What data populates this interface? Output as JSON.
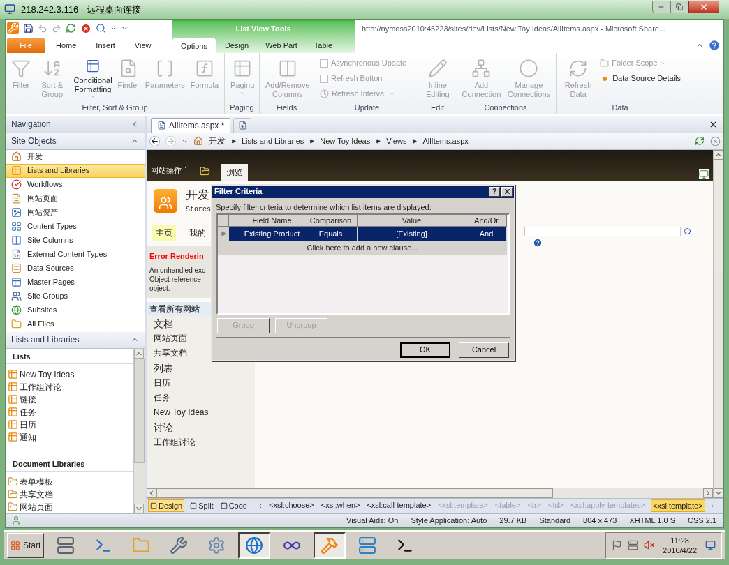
{
  "window": {
    "title": "218.242.3.116 - 远程桌面连接"
  },
  "app": {
    "title": "http://nymoss2010:45223/sites/dev/Lists/New Toy Ideas/AllItems.aspx  -  Microsoft Share...",
    "contextual_group": "List View Tools"
  },
  "ribbon_tabs": [
    {
      "label": "File",
      "kind": "file",
      "selected": false
    },
    {
      "label": "Home",
      "kind": "plain",
      "selected": false
    },
    {
      "label": "Insert",
      "kind": "plain",
      "selected": false
    },
    {
      "label": "View",
      "kind": "plain",
      "selected": false
    },
    {
      "label": "Options",
      "kind": "contextual",
      "selected": true
    },
    {
      "label": "Design",
      "kind": "contextual",
      "selected": false
    },
    {
      "label": "Web Part",
      "kind": "contextual",
      "selected": false
    },
    {
      "label": "Table",
      "kind": "contextual",
      "selected": false
    }
  ],
  "ribbon_groups": [
    {
      "title": "Filter, Sort & Group",
      "commands": [
        {
          "label": "Filter",
          "kind": "large",
          "disabled": true,
          "dropdown": false
        },
        {
          "label": "Sort & Group",
          "kind": "large",
          "disabled": true,
          "dropdown": false
        },
        {
          "label": "Conditional Formatting",
          "kind": "large",
          "disabled": false,
          "dropdown": true
        },
        {
          "label": "Finder",
          "kind": "large",
          "disabled": true,
          "dropdown": false
        },
        {
          "label": "Parameters",
          "kind": "large",
          "disabled": true,
          "dropdown": false
        },
        {
          "label": "Formula",
          "kind": "large",
          "disabled": true,
          "dropdown": false
        }
      ]
    },
    {
      "title": "Paging",
      "commands": [
        {
          "label": "Paging",
          "kind": "large",
          "disabled": true,
          "dropdown": true
        }
      ]
    },
    {
      "title": "Fields",
      "commands": [
        {
          "label": "Add/Remove Columns",
          "kind": "large",
          "disabled": true,
          "dropdown": false
        }
      ]
    },
    {
      "title": "Update",
      "commands": [
        {
          "label": "Asynchronous Update",
          "kind": "checkbox",
          "disabled": true,
          "checked": false
        },
        {
          "label": "Refresh Button",
          "kind": "checkbox",
          "disabled": true,
          "checked": false
        },
        {
          "label": "Refresh Interval",
          "kind": "small",
          "disabled": true,
          "dropdown": true
        }
      ]
    },
    {
      "title": "Edit",
      "commands": [
        {
          "label": "Inline Editing",
          "kind": "large",
          "disabled": true,
          "dropdown": false
        }
      ]
    },
    {
      "title": "Connections",
      "commands": [
        {
          "label": "Add Connection",
          "kind": "large",
          "disabled": true,
          "dropdown": false
        },
        {
          "label": "Manage Connections",
          "kind": "large",
          "disabled": true,
          "dropdown": false
        }
      ]
    },
    {
      "title": "Data",
      "commands": [
        {
          "label": "Refresh Data",
          "kind": "large",
          "disabled": true,
          "dropdown": false
        },
        {
          "label": "Folder Scope",
          "kind": "small",
          "disabled": true,
          "dropdown": true
        },
        {
          "label": "Data Source Details",
          "kind": "small",
          "disabled": false,
          "dropdown": false
        }
      ]
    }
  ],
  "navigation": {
    "title": "Navigation",
    "site_objects": {
      "title": "Site Objects",
      "items": [
        {
          "label": "开发",
          "selected": false
        },
        {
          "label": "Lists and Libraries",
          "selected": true
        },
        {
          "label": "Workflows",
          "selected": false
        },
        {
          "label": "网站页面",
          "selected": false
        },
        {
          "label": "网站资产",
          "selected": false
        },
        {
          "label": "Content Types",
          "selected": false
        },
        {
          "label": "Site Columns",
          "selected": false
        },
        {
          "label": "External Content Types",
          "selected": false
        },
        {
          "label": "Data Sources",
          "selected": false
        },
        {
          "label": "Master Pages",
          "selected": false
        },
        {
          "label": "Site Groups",
          "selected": false
        },
        {
          "label": "Subsites",
          "selected": false
        },
        {
          "label": "All Files",
          "selected": false
        }
      ]
    },
    "lists_and_libraries": {
      "title": "Lists and Libraries",
      "groups": [
        {
          "title": "Lists",
          "kind": "list",
          "items": [
            "New Toy Ideas",
            "工作组讨论",
            "链接",
            "任务",
            "日历",
            "通知"
          ]
        },
        {
          "title": "Document Libraries",
          "kind": "library",
          "items": [
            "表单模板",
            "共享文档",
            "网站页面"
          ]
        }
      ]
    }
  },
  "editor": {
    "tabs": [
      {
        "label": "AllItems.aspx *",
        "selected": true
      }
    ],
    "breadcrumb": [
      "开发",
      "Lists and Libraries",
      "New Toy Ideas",
      "Views",
      "AllItems.aspx"
    ],
    "page": {
      "site_actions": "网站操作",
      "ribbon_tabs": [
        {
          "label": "浏览",
          "selected": true
        }
      ],
      "site_title": "开发",
      "site_subtitle": "Stores",
      "top_links": [
        {
          "label": "主页",
          "selected": true
        },
        {
          "label": "我的",
          "selected": false
        }
      ],
      "error_title": "Error Renderin",
      "error_lines": [
        "An unhandled exc",
        "Object reference",
        "object."
      ],
      "quick_launch_heading": "查看所有网站",
      "quick_launch": [
        {
          "label": "文档",
          "kind": "heading"
        },
        {
          "label": "网站页面",
          "kind": "link"
        },
        {
          "label": "共享文档",
          "kind": "link"
        },
        {
          "label": "列表",
          "kind": "heading"
        },
        {
          "label": "日历",
          "kind": "link"
        },
        {
          "label": "任务",
          "kind": "link"
        },
        {
          "label": "New Toy Ideas",
          "kind": "link"
        },
        {
          "label": "讨论",
          "kind": "heading"
        },
        {
          "label": "工作组讨论",
          "kind": "link"
        }
      ]
    },
    "views": [
      {
        "label": "Design",
        "selected": true
      },
      {
        "label": "Split",
        "selected": false
      },
      {
        "label": "Code",
        "selected": false
      }
    ],
    "tag_path": [
      {
        "label": "<xsl:choose>",
        "dimmed": false,
        "selected": false
      },
      {
        "label": "<xsl:when>",
        "dimmed": false,
        "selected": false
      },
      {
        "label": "<xsl:call-template>",
        "dimmed": false,
        "selected": false
      },
      {
        "label": "<xsl:template>",
        "dimmed": true,
        "selected": false
      },
      {
        "label": "<table>",
        "dimmed": true,
        "selected": false
      },
      {
        "label": "<tr>",
        "dimmed": true,
        "selected": false
      },
      {
        "label": "<td>",
        "dimmed": true,
        "selected": false
      },
      {
        "label": "<xsl:apply-templates>",
        "dimmed": true,
        "selected": false
      },
      {
        "label": "<xsl:template>",
        "dimmed": false,
        "selected": true
      }
    ]
  },
  "dialog": {
    "title": "Filter Criteria",
    "help": "?",
    "instruction": "Specify filter criteria to determine which list items are displayed:",
    "columns": [
      "Field Name",
      "Comparison",
      "Value",
      "And/Or"
    ],
    "clauses": [
      {
        "cells": [
          "Existing Product",
          "Equals",
          "[Existing]",
          "And"
        ],
        "selected": true
      }
    ],
    "add_clause": "Click here to add a new clause...",
    "buttons": [
      {
        "label": "Group",
        "disabled": true,
        "default": false
      },
      {
        "label": "Ungroup",
        "disabled": true,
        "default": false
      },
      {
        "label": "OK",
        "disabled": false,
        "default": true
      },
      {
        "label": "Cancel",
        "disabled": false,
        "default": false
      }
    ]
  },
  "status_bar": [
    "Visual Aids: On",
    "Style Application: Auto",
    "29.7 KB",
    "Standard",
    "804 x 473",
    "XHTML 1.0 S",
    "CSS 2.1"
  ],
  "taskbar": {
    "start": "Start",
    "buttons": [
      {
        "selected": false
      },
      {
        "selected": false
      },
      {
        "selected": false
      },
      {
        "selected": false
      },
      {
        "selected": false
      },
      {
        "selected": true
      },
      {
        "selected": false
      },
      {
        "selected": true
      },
      {
        "selected": false
      },
      {
        "selected": false
      }
    ],
    "time": "11:28",
    "date": "2010/4/22"
  }
}
